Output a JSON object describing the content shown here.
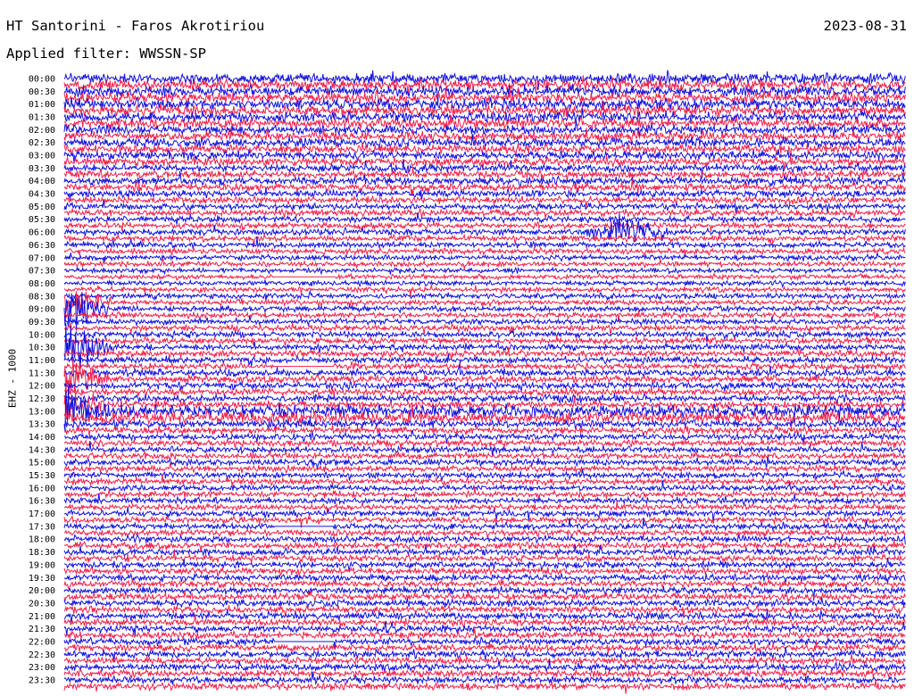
{
  "header": {
    "station": "HT Santorini - Faros Akrotiriou",
    "date": "2023-08-31",
    "filter": "Applied filter: WWSSN-SP"
  },
  "channel_label": "EHZ - 1000",
  "colors": {
    "trace_a": "#1111dd",
    "trace_b": "#f0204a",
    "background": "#ffffff",
    "text": "#000000"
  },
  "chart_data": {
    "type": "seismogram-helicorder",
    "line_minutes": 15,
    "trace_colors_alternate": [
      "blue",
      "red"
    ],
    "y_tick_labels": [
      "00:00",
      "00:30",
      "01:00",
      "01:30",
      "02:00",
      "02:30",
      "03:00",
      "03:30",
      "04:00",
      "04:30",
      "05:00",
      "05:30",
      "06:00",
      "06:30",
      "07:00",
      "07:30",
      "08:00",
      "08:30",
      "09:00",
      "09:30",
      "10:00",
      "10:30",
      "11:00",
      "11:30",
      "12:00",
      "12:30",
      "13:00",
      "13:30",
      "14:00",
      "14:30",
      "15:00",
      "15:30",
      "16:00",
      "16:30",
      "17:00",
      "17:30",
      "18:00",
      "18:30",
      "19:00",
      "19:30",
      "20:00",
      "20:30",
      "21:00",
      "21:30",
      "22:00",
      "22:30",
      "23:00",
      "23:30"
    ],
    "noise_level_by_half_hour": [
      1.3,
      1.3,
      1.25,
      1.2,
      1.15,
      1.1,
      1.0,
      0.95,
      0.95,
      0.85,
      0.8,
      0.75,
      0.75,
      0.7,
      0.65,
      0.6,
      0.6,
      0.65,
      0.7,
      0.7,
      0.75,
      0.8,
      0.8,
      0.85,
      0.85,
      0.9,
      1.5,
      0.9,
      0.8,
      0.75,
      0.75,
      0.75,
      0.75,
      0.75,
      0.75,
      0.75,
      0.8,
      0.8,
      0.8,
      0.8,
      0.85,
      0.85,
      0.85,
      0.85,
      0.85,
      0.85,
      0.85,
      0.85
    ],
    "events": [
      {
        "time": "06:10",
        "amplitude": "medium"
      },
      {
        "time": "08:45",
        "amplitude": "medium"
      },
      {
        "time": "09:00",
        "amplitude": "high"
      },
      {
        "time": "10:30",
        "amplitude": "high"
      },
      {
        "time": "11:45",
        "amplitude": "high"
      },
      {
        "time": "12:45",
        "amplitude": "medium"
      },
      {
        "time": "13:00",
        "amplitude": "high"
      }
    ],
    "data_gaps": [
      {
        "time": "07:45",
        "note": "line partially flat"
      },
      {
        "time": "11:15",
        "note": "line partially flat"
      },
      {
        "time": "17:30",
        "note": "short gap"
      },
      {
        "time": "22:00",
        "note": "short gap"
      }
    ]
  }
}
